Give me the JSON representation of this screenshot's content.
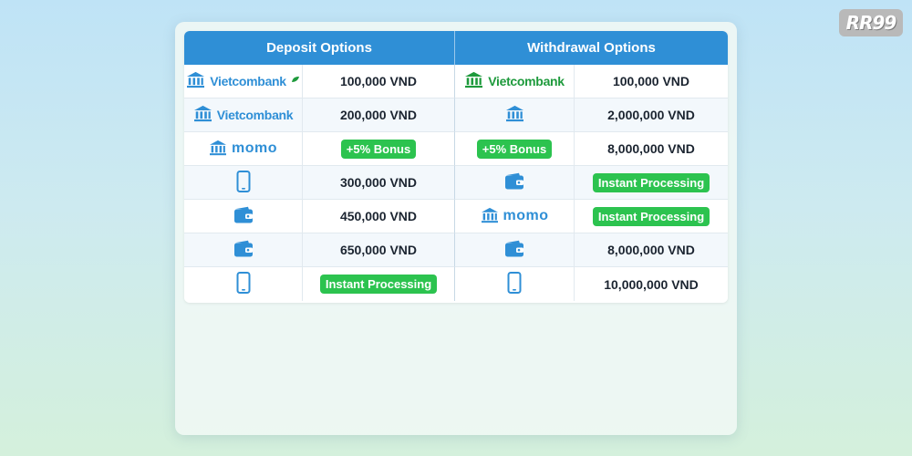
{
  "brand": {
    "logo_text": "RR99"
  },
  "colors": {
    "header_bg": "#2f8fd6",
    "icon_blue": "#2f8fd6",
    "icon_green": "#1e9a3c",
    "badge_green": "#2cc34f"
  },
  "table": {
    "headers": [
      "Deposit Options",
      "Withdrawal Options"
    ],
    "rows": [
      {
        "deposit_method": "Vietcombank",
        "deposit_amount": "100,000 VND",
        "withdraw_method": "Vietcombank",
        "withdraw_amount": "100,000 VND"
      },
      {
        "deposit_method": "Vietcombank",
        "deposit_amount": "200,000 VND",
        "withdraw_icon": "bank-icon",
        "withdraw_amount": "2,000,000 VND"
      },
      {
        "deposit_method": "momo",
        "deposit_badge": "+5% Bonus",
        "withdraw_badge": "+5% Bonus",
        "withdraw_amount": "8,000,000 VND"
      },
      {
        "deposit_icon": "phone-icon",
        "deposit_amount": "300,000 VND",
        "withdraw_icon": "wallet-icon",
        "withdraw_badge": "Instant Processing"
      },
      {
        "deposit_icon": "wallet-icon",
        "deposit_amount": "450,000 VND",
        "withdraw_method": "momo",
        "withdraw_badge": "Instant Processing"
      },
      {
        "deposit_icon": "wallet-icon",
        "deposit_amount": "650,000 VND",
        "withdraw_icon": "wallet-icon",
        "withdraw_amount": "8,000,000 VND"
      },
      {
        "deposit_icon": "phone-icon",
        "deposit_badge": "Instant Processing",
        "withdraw_icon": "phone-icon",
        "withdraw_amount": "10,000,000 VND"
      }
    ]
  }
}
